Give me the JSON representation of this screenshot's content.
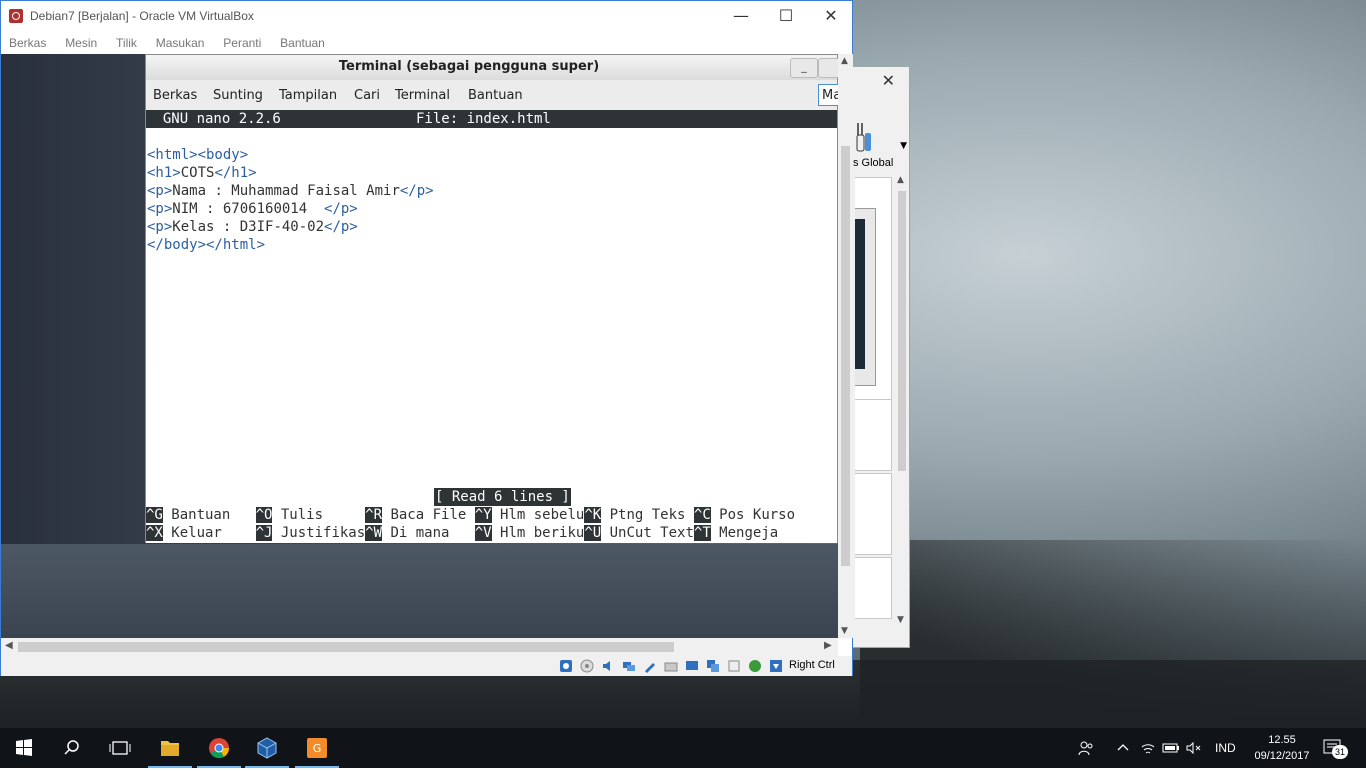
{
  "vbox": {
    "title": "Debian7 [Berjalan] - Oracle VM VirtualBox",
    "minimize": "—",
    "maximize": "☐",
    "close": "✕",
    "menu": [
      "Berkas",
      "Mesin",
      "Tilik",
      "Masukan",
      "Peranti",
      "Bantuan"
    ],
    "host_key": "Right Ctrl"
  },
  "terminal": {
    "title": "Terminal (sebagai pengguna super)",
    "menu": [
      "Berkas",
      "Sunting",
      "Tampilan",
      "Cari",
      "Terminal",
      "Bantuan"
    ],
    "menu_overflow": "Ma",
    "minimize_glyph": "_"
  },
  "nano": {
    "version": "  GNU nano 2.2.6",
    "file": "File: index.html",
    "lines": [
      {
        "open": "<html><body>",
        "text": "",
        "close": ""
      },
      {
        "open": "<h1>",
        "text": "COTS",
        "close": "</h1>"
      },
      {
        "open": "<p>",
        "text": "Nama : Muhammad Faisal Amir",
        "close": "</p>"
      },
      {
        "open": "<p>",
        "text": "NIM : 6706160014  ",
        "close": "</p>"
      },
      {
        "open": "<p>",
        "text": "Kelas : D3IF-40-02",
        "close": "</p>"
      },
      {
        "open": "</body></html>",
        "text": "",
        "close": ""
      }
    ],
    "status": "[ Read 6 lines ]",
    "shortcuts_row1": [
      {
        "key": "^G",
        "label": " Bantuan   "
      },
      {
        "key": "^O",
        "label": " Tulis     "
      },
      {
        "key": "^R",
        "label": " Baca File "
      },
      {
        "key": "^Y",
        "label": " Hlm sebelu"
      },
      {
        "key": "^K",
        "label": " Ptng Teks "
      },
      {
        "key": "^C",
        "label": " Pos Kurso"
      }
    ],
    "shortcuts_row2": [
      {
        "key": "^X",
        "label": " Keluar    "
      },
      {
        "key": "^J",
        "label": " Justifikas"
      },
      {
        "key": "^W",
        "label": " Di mana   "
      },
      {
        "key": "^V",
        "label": " Hlm beriku"
      },
      {
        "key": "^U",
        "label": " UnCut Text"
      },
      {
        "key": "^T",
        "label": " Mengeja"
      }
    ]
  },
  "background_window": {
    "label": "s Global",
    "close": "✕"
  },
  "taskbar": {
    "language": "IND",
    "time": "12.55",
    "date": "09/12/2017",
    "notification_count": "31",
    "apps": [
      "windows-start",
      "search",
      "task-view",
      "file-explorer",
      "chrome",
      "virtualbox",
      "pdf-reader"
    ]
  },
  "colors": {
    "accent": "#3a7bd5",
    "nano_bar": "#2e3436",
    "html_tag": "#2c5fa0",
    "taskbar": "#101418"
  }
}
